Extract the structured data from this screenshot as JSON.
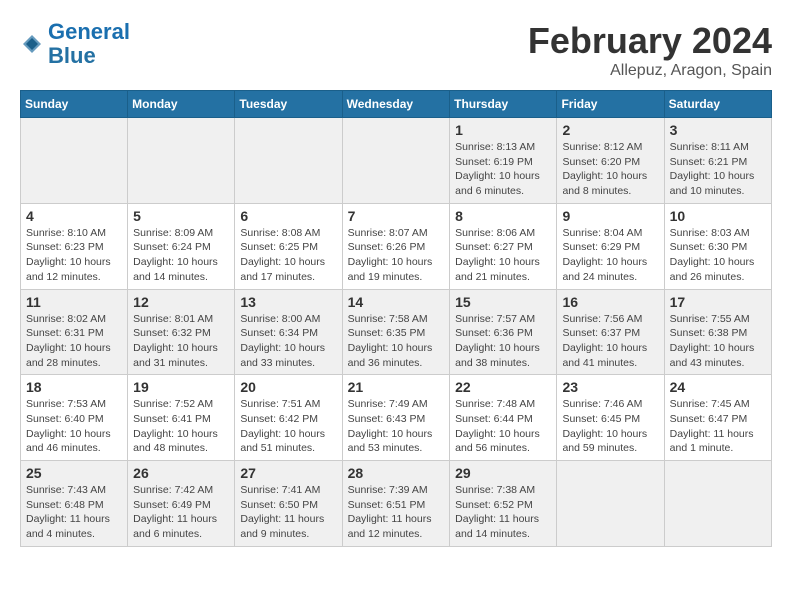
{
  "header": {
    "logo_general": "General",
    "logo_blue": "Blue",
    "month_title": "February 2024",
    "location": "Allepuz, Aragon, Spain"
  },
  "calendar": {
    "days_of_week": [
      "Sunday",
      "Monday",
      "Tuesday",
      "Wednesday",
      "Thursday",
      "Friday",
      "Saturday"
    ],
    "weeks": [
      [
        {
          "day": "",
          "info": ""
        },
        {
          "day": "",
          "info": ""
        },
        {
          "day": "",
          "info": ""
        },
        {
          "day": "",
          "info": ""
        },
        {
          "day": "1",
          "info": "Sunrise: 8:13 AM\nSunset: 6:19 PM\nDaylight: 10 hours\nand 6 minutes."
        },
        {
          "day": "2",
          "info": "Sunrise: 8:12 AM\nSunset: 6:20 PM\nDaylight: 10 hours\nand 8 minutes."
        },
        {
          "day": "3",
          "info": "Sunrise: 8:11 AM\nSunset: 6:21 PM\nDaylight: 10 hours\nand 10 minutes."
        }
      ],
      [
        {
          "day": "4",
          "info": "Sunrise: 8:10 AM\nSunset: 6:23 PM\nDaylight: 10 hours\nand 12 minutes."
        },
        {
          "day": "5",
          "info": "Sunrise: 8:09 AM\nSunset: 6:24 PM\nDaylight: 10 hours\nand 14 minutes."
        },
        {
          "day": "6",
          "info": "Sunrise: 8:08 AM\nSunset: 6:25 PM\nDaylight: 10 hours\nand 17 minutes."
        },
        {
          "day": "7",
          "info": "Sunrise: 8:07 AM\nSunset: 6:26 PM\nDaylight: 10 hours\nand 19 minutes."
        },
        {
          "day": "8",
          "info": "Sunrise: 8:06 AM\nSunset: 6:27 PM\nDaylight: 10 hours\nand 21 minutes."
        },
        {
          "day": "9",
          "info": "Sunrise: 8:04 AM\nSunset: 6:29 PM\nDaylight: 10 hours\nand 24 minutes."
        },
        {
          "day": "10",
          "info": "Sunrise: 8:03 AM\nSunset: 6:30 PM\nDaylight: 10 hours\nand 26 minutes."
        }
      ],
      [
        {
          "day": "11",
          "info": "Sunrise: 8:02 AM\nSunset: 6:31 PM\nDaylight: 10 hours\nand 28 minutes."
        },
        {
          "day": "12",
          "info": "Sunrise: 8:01 AM\nSunset: 6:32 PM\nDaylight: 10 hours\nand 31 minutes."
        },
        {
          "day": "13",
          "info": "Sunrise: 8:00 AM\nSunset: 6:34 PM\nDaylight: 10 hours\nand 33 minutes."
        },
        {
          "day": "14",
          "info": "Sunrise: 7:58 AM\nSunset: 6:35 PM\nDaylight: 10 hours\nand 36 minutes."
        },
        {
          "day": "15",
          "info": "Sunrise: 7:57 AM\nSunset: 6:36 PM\nDaylight: 10 hours\nand 38 minutes."
        },
        {
          "day": "16",
          "info": "Sunrise: 7:56 AM\nSunset: 6:37 PM\nDaylight: 10 hours\nand 41 minutes."
        },
        {
          "day": "17",
          "info": "Sunrise: 7:55 AM\nSunset: 6:38 PM\nDaylight: 10 hours\nand 43 minutes."
        }
      ],
      [
        {
          "day": "18",
          "info": "Sunrise: 7:53 AM\nSunset: 6:40 PM\nDaylight: 10 hours\nand 46 minutes."
        },
        {
          "day": "19",
          "info": "Sunrise: 7:52 AM\nSunset: 6:41 PM\nDaylight: 10 hours\nand 48 minutes."
        },
        {
          "day": "20",
          "info": "Sunrise: 7:51 AM\nSunset: 6:42 PM\nDaylight: 10 hours\nand 51 minutes."
        },
        {
          "day": "21",
          "info": "Sunrise: 7:49 AM\nSunset: 6:43 PM\nDaylight: 10 hours\nand 53 minutes."
        },
        {
          "day": "22",
          "info": "Sunrise: 7:48 AM\nSunset: 6:44 PM\nDaylight: 10 hours\nand 56 minutes."
        },
        {
          "day": "23",
          "info": "Sunrise: 7:46 AM\nSunset: 6:45 PM\nDaylight: 10 hours\nand 59 minutes."
        },
        {
          "day": "24",
          "info": "Sunrise: 7:45 AM\nSunset: 6:47 PM\nDaylight: 11 hours\nand 1 minute."
        }
      ],
      [
        {
          "day": "25",
          "info": "Sunrise: 7:43 AM\nSunset: 6:48 PM\nDaylight: 11 hours\nand 4 minutes."
        },
        {
          "day": "26",
          "info": "Sunrise: 7:42 AM\nSunset: 6:49 PM\nDaylight: 11 hours\nand 6 minutes."
        },
        {
          "day": "27",
          "info": "Sunrise: 7:41 AM\nSunset: 6:50 PM\nDaylight: 11 hours\nand 9 minutes."
        },
        {
          "day": "28",
          "info": "Sunrise: 7:39 AM\nSunset: 6:51 PM\nDaylight: 11 hours\nand 12 minutes."
        },
        {
          "day": "29",
          "info": "Sunrise: 7:38 AM\nSunset: 6:52 PM\nDaylight: 11 hours\nand 14 minutes."
        },
        {
          "day": "",
          "info": ""
        },
        {
          "day": "",
          "info": ""
        }
      ]
    ]
  }
}
